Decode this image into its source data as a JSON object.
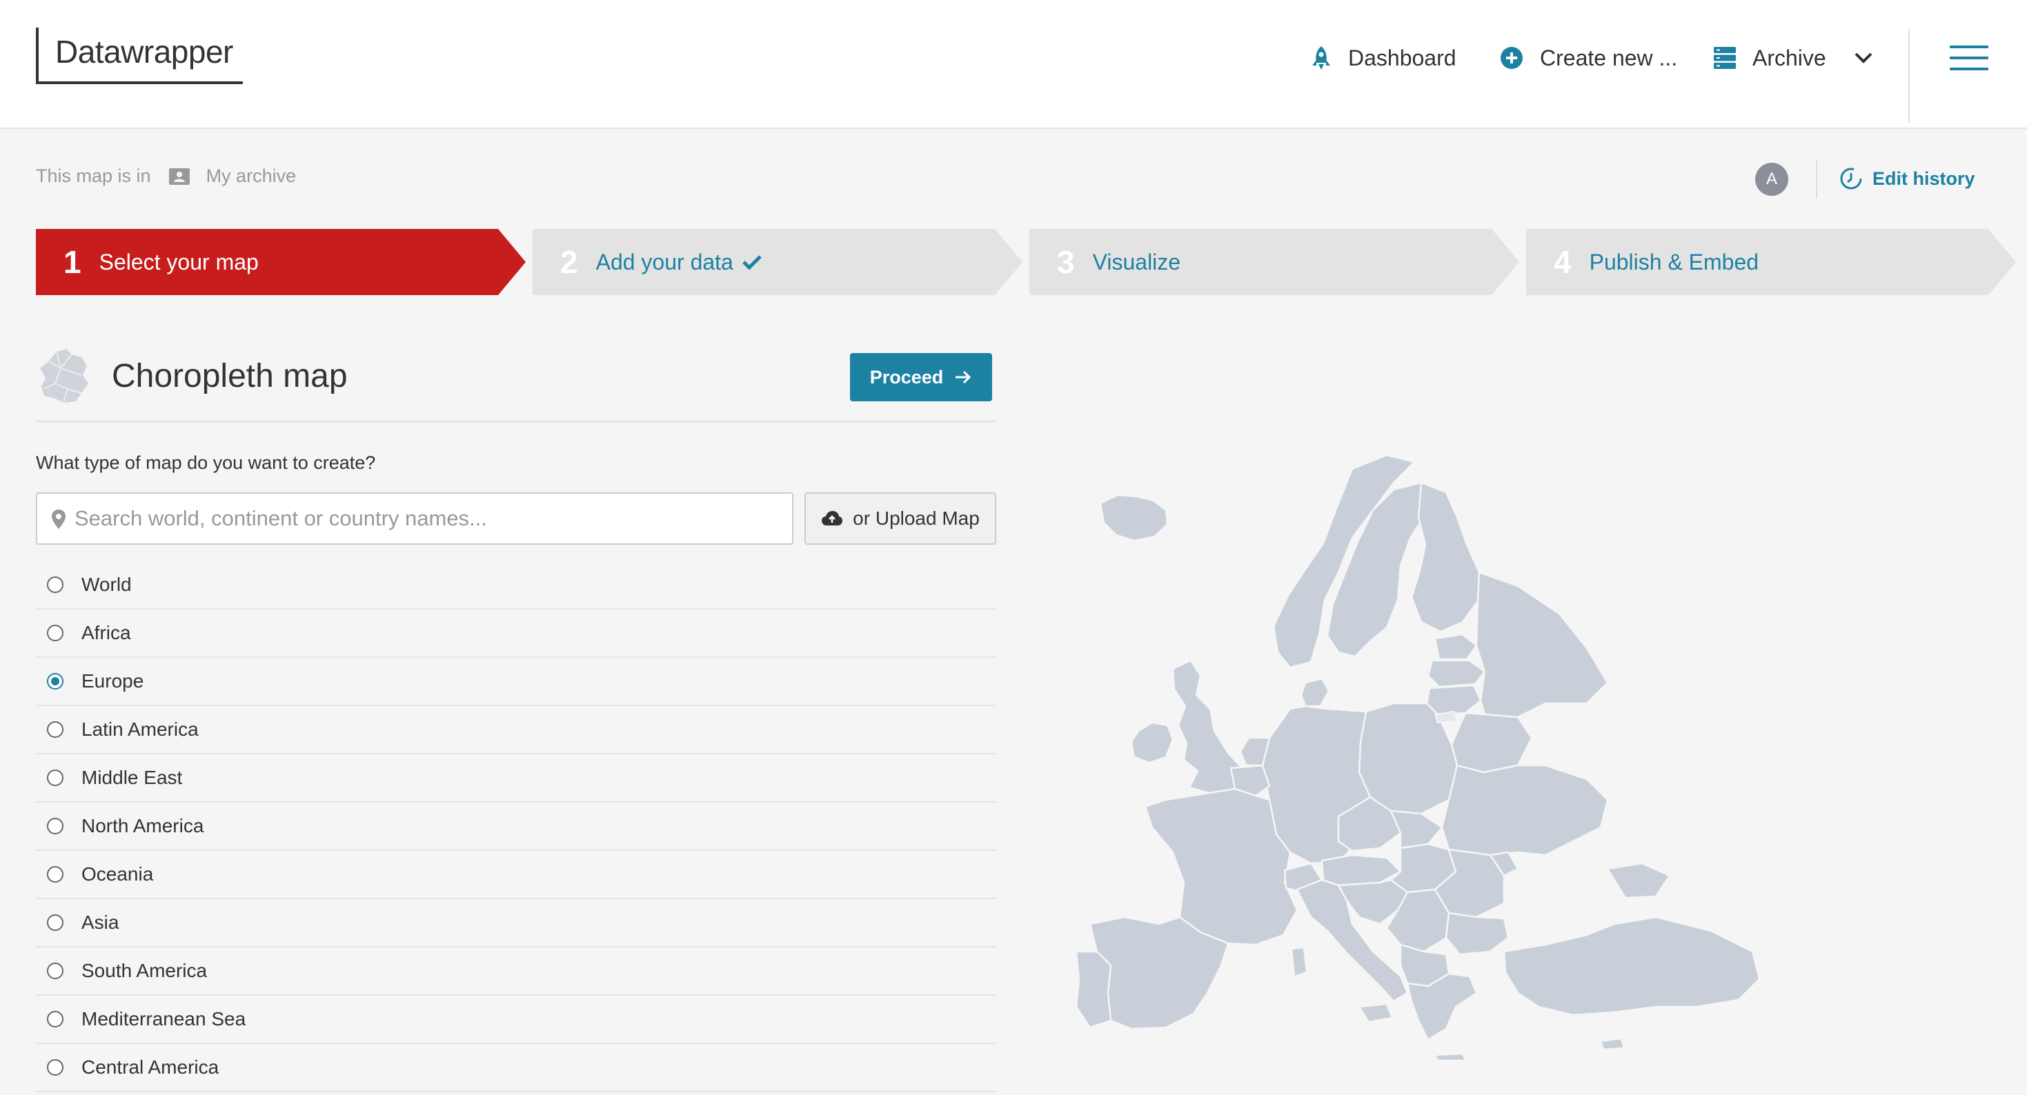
{
  "header": {
    "logo": "Datawrapper",
    "nav": {
      "dashboard": "Dashboard",
      "create_new": "Create new ...",
      "archive": "Archive"
    }
  },
  "meta": {
    "location_prefix": "This map is in",
    "folder": "My archive",
    "avatar_initial": "A",
    "edit_history": "Edit history"
  },
  "steps": [
    {
      "num": "1",
      "label": "Select your map",
      "state": "active"
    },
    {
      "num": "2",
      "label": "Add your data",
      "state": "done"
    },
    {
      "num": "3",
      "label": "Visualize",
      "state": "inactive"
    },
    {
      "num": "4",
      "label": "Publish & Embed",
      "state": "inactive"
    }
  ],
  "panel": {
    "title": "Choropleth map",
    "proceed": "Proceed",
    "question": "What type of map do you want to create?",
    "search_placeholder": "Search world, continent or country names...",
    "upload": "or Upload Map",
    "options": [
      {
        "label": "World",
        "checked": false
      },
      {
        "label": "Africa",
        "checked": false
      },
      {
        "label": "Europe",
        "checked": true
      },
      {
        "label": "Latin America",
        "checked": false
      },
      {
        "label": "Middle East",
        "checked": false
      },
      {
        "label": "North America",
        "checked": false
      },
      {
        "label": "Oceania",
        "checked": false
      },
      {
        "label": "Asia",
        "checked": false
      },
      {
        "label": "South America",
        "checked": false
      },
      {
        "label": "Mediterranean Sea",
        "checked": false
      },
      {
        "label": "Central America",
        "checked": false
      }
    ]
  },
  "colors": {
    "brand_red": "#c71e1d",
    "accent_blue": "#1d81a2",
    "map_fill": "#c8cfd8"
  }
}
